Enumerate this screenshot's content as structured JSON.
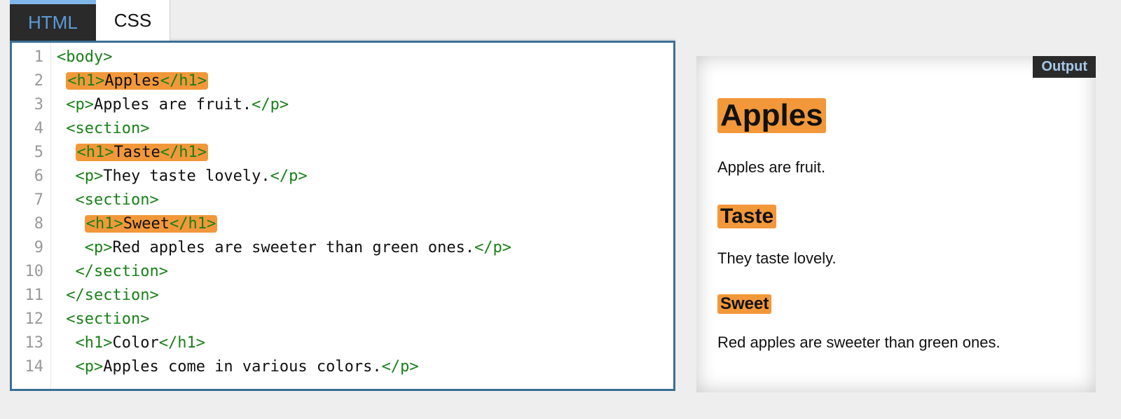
{
  "tabs": {
    "html": "HTML",
    "css": "CSS"
  },
  "output_label": "Output",
  "code_lines": [
    {
      "n": 1,
      "indent": 0,
      "hl": false,
      "open": "<body>",
      "text": "",
      "close": "",
      "selfclose": true
    },
    {
      "n": 2,
      "indent": 1,
      "hl": true,
      "open": "<h1>",
      "text": "Apples",
      "close": "</h1>"
    },
    {
      "n": 3,
      "indent": 1,
      "hl": false,
      "open": "<p>",
      "text": "Apples are fruit.",
      "close": "</p>"
    },
    {
      "n": 4,
      "indent": 1,
      "hl": false,
      "open": "<section>",
      "text": "",
      "close": "",
      "selfclose": true
    },
    {
      "n": 5,
      "indent": 2,
      "hl": true,
      "open": "<h1>",
      "text": "Taste",
      "close": "</h1>"
    },
    {
      "n": 6,
      "indent": 2,
      "hl": false,
      "open": "<p>",
      "text": "They taste lovely.",
      "close": "</p>"
    },
    {
      "n": 7,
      "indent": 2,
      "hl": false,
      "open": "<section>",
      "text": "",
      "close": "",
      "selfclose": true
    },
    {
      "n": 8,
      "indent": 3,
      "hl": true,
      "open": "<h1>",
      "text": "Sweet",
      "close": "</h1>"
    },
    {
      "n": 9,
      "indent": 3,
      "hl": false,
      "open": "<p>",
      "text": "Red apples are sweeter than green ones.",
      "close": "</p>"
    },
    {
      "n": 10,
      "indent": 2,
      "hl": false,
      "open": "</section>",
      "text": "",
      "close": "",
      "selfclose": true
    },
    {
      "n": 11,
      "indent": 1,
      "hl": false,
      "open": "</section>",
      "text": "",
      "close": "",
      "selfclose": true
    },
    {
      "n": 12,
      "indent": 1,
      "hl": false,
      "open": "<section>",
      "text": "",
      "close": "",
      "selfclose": true
    },
    {
      "n": 13,
      "indent": 2,
      "hl": false,
      "open": "<h1>",
      "text": "Color",
      "close": "</h1>"
    },
    {
      "n": 14,
      "indent": 2,
      "hl": false,
      "open": "<p>",
      "text": "Apples come in various colors.",
      "close": "</p>",
      "partial": true
    }
  ],
  "output": {
    "h1": "Apples",
    "p1": "Apples are fruit.",
    "h2": "Taste",
    "p2": "They taste lovely.",
    "h3": "Sweet",
    "p3": "Red apples are sweeter than green ones."
  }
}
